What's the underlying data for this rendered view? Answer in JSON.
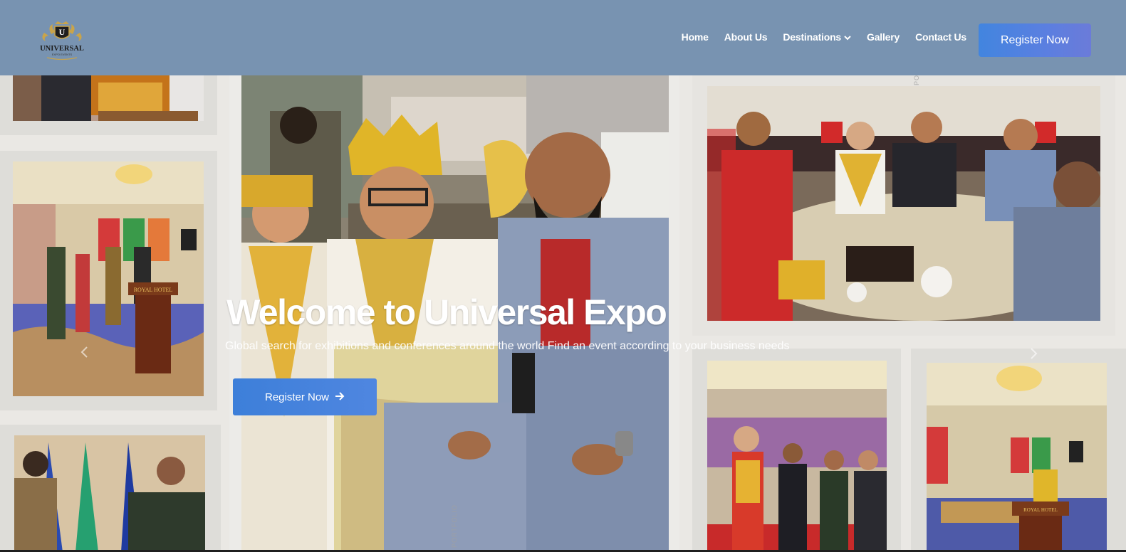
{
  "brand": {
    "name": "UNIVERSAL",
    "tagline": "EXPO EVENTS",
    "monogram": "U"
  },
  "nav": {
    "items": [
      {
        "label": "Home"
      },
      {
        "label": "About Us"
      },
      {
        "label": "Destinations",
        "has_dropdown": true
      },
      {
        "label": "Gallery"
      },
      {
        "label": "Contact Us"
      }
    ],
    "cta": "Register Now"
  },
  "hero": {
    "title": "Welcome to Universal Expo",
    "subtitle": "Global search for exhibitions and conferences around the world Find an event according to your business needs",
    "cta": "Register Now",
    "cta_icon": "arrow-right-icon",
    "prev_icon": "chevron-left-icon",
    "next_icon": "chevron-right-icon",
    "podium_sign": "ROYAL HOTEL"
  },
  "side_texts": {
    "portfolio": "PORTFOLIO",
    "upper": "PORTFOLIO"
  },
  "colors": {
    "navbar": "#7893b1",
    "button": "#4a84df",
    "tile_frame": "#deddd9"
  }
}
